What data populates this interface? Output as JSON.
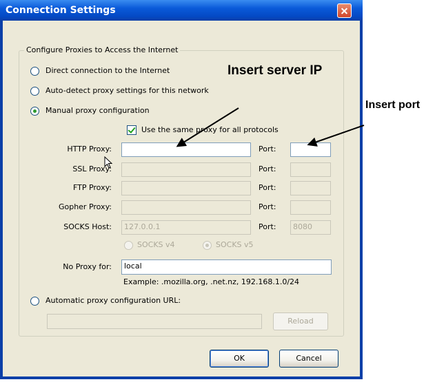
{
  "window": {
    "title": "Connection Settings"
  },
  "group": {
    "legend": "Configure Proxies to Access the Internet"
  },
  "options": {
    "direct": "Direct connection to the Internet",
    "auto_detect": "Auto-detect proxy settings for this network",
    "manual": "Manual proxy configuration",
    "auto_url": "Automatic proxy configuration URL:"
  },
  "manual": {
    "same_proxy_label": "Use the same proxy for all protocols",
    "rows": [
      {
        "label": "HTTP Proxy:",
        "value": "",
        "port_label": "Port:",
        "port": ""
      },
      {
        "label": "SSL Proxy:",
        "value": "",
        "port_label": "Port:",
        "port": ""
      },
      {
        "label": "FTP Proxy:",
        "value": "",
        "port_label": "Port:",
        "port": ""
      },
      {
        "label": "Gopher Proxy:",
        "value": "",
        "port_label": "Port:",
        "port": ""
      },
      {
        "label": "SOCKS Host:",
        "value": "127.0.0.1",
        "port_label": "Port:",
        "port": "8080"
      }
    ],
    "socks_v4": "SOCKS v4",
    "socks_v5": "SOCKS v5",
    "no_proxy_label": "No Proxy for:",
    "no_proxy_value": "local",
    "example": "Example: .mozilla.org, .net.nz, 192.168.1.0/24"
  },
  "auto_url_value": "",
  "buttons": {
    "reload": "Reload",
    "ok": "OK",
    "cancel": "Cancel"
  },
  "annotations": {
    "server_ip": "Insert server IP",
    "port": "Insert port"
  },
  "colors": {
    "titlebar": "#0a5ad9",
    "dialog_bg": "#ece9d8",
    "accent_check": "#21a121"
  }
}
